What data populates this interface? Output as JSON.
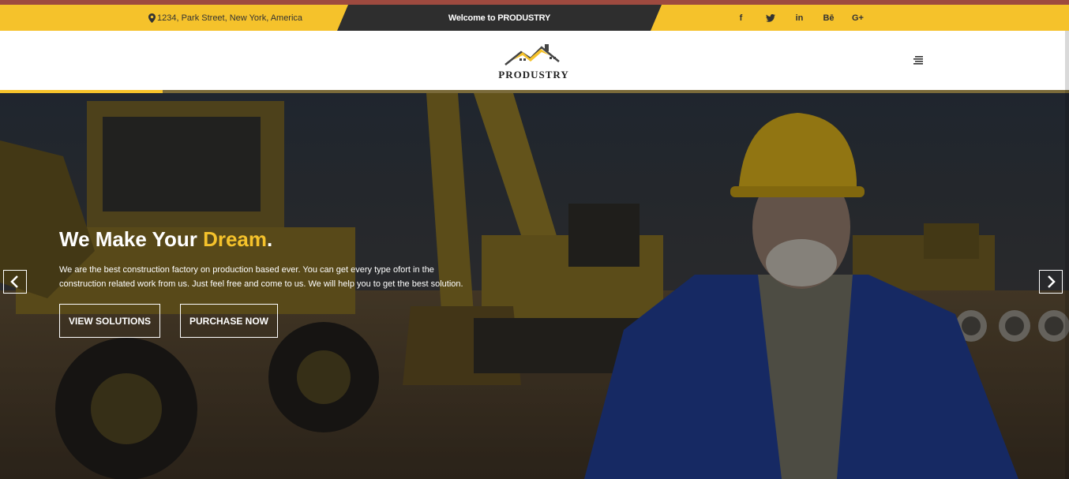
{
  "topbar": {
    "address": "1234, Park Street, New York, America",
    "welcome": "Welcome to PRODUSTRY",
    "socials": [
      {
        "icon": "facebook-icon",
        "label": "f"
      },
      {
        "icon": "twitter-icon",
        "label": ""
      },
      {
        "icon": "linkedin-icon",
        "label": "in"
      },
      {
        "icon": "behance-icon",
        "label": "Bē"
      },
      {
        "icon": "google-plus-icon",
        "label": "G+"
      }
    ]
  },
  "header": {
    "logo_text": "PRODUSTRY",
    "menu_icon": "hamburger-menu-icon"
  },
  "slider": {
    "progress": 0.152
  },
  "hero": {
    "title_prefix": "We Make Your ",
    "title_highlight": "Dream",
    "title_suffix": ".",
    "description": "We are the best construction factory on production based ever. You can get every type ofort in the construction related work from us. Just feel free and come to us. We will help you to get the best solution.",
    "buttons": {
      "view_solutions": "VIEW SOLUTIONS",
      "purchase_now": "PURCHASE NOW"
    },
    "prev_icon": "chevron-left-icon",
    "next_icon": "chevron-right-icon"
  },
  "colors": {
    "accent": "#f5c22b",
    "dark": "#2e2e2e",
    "top_accent": "#9e4a3f"
  }
}
